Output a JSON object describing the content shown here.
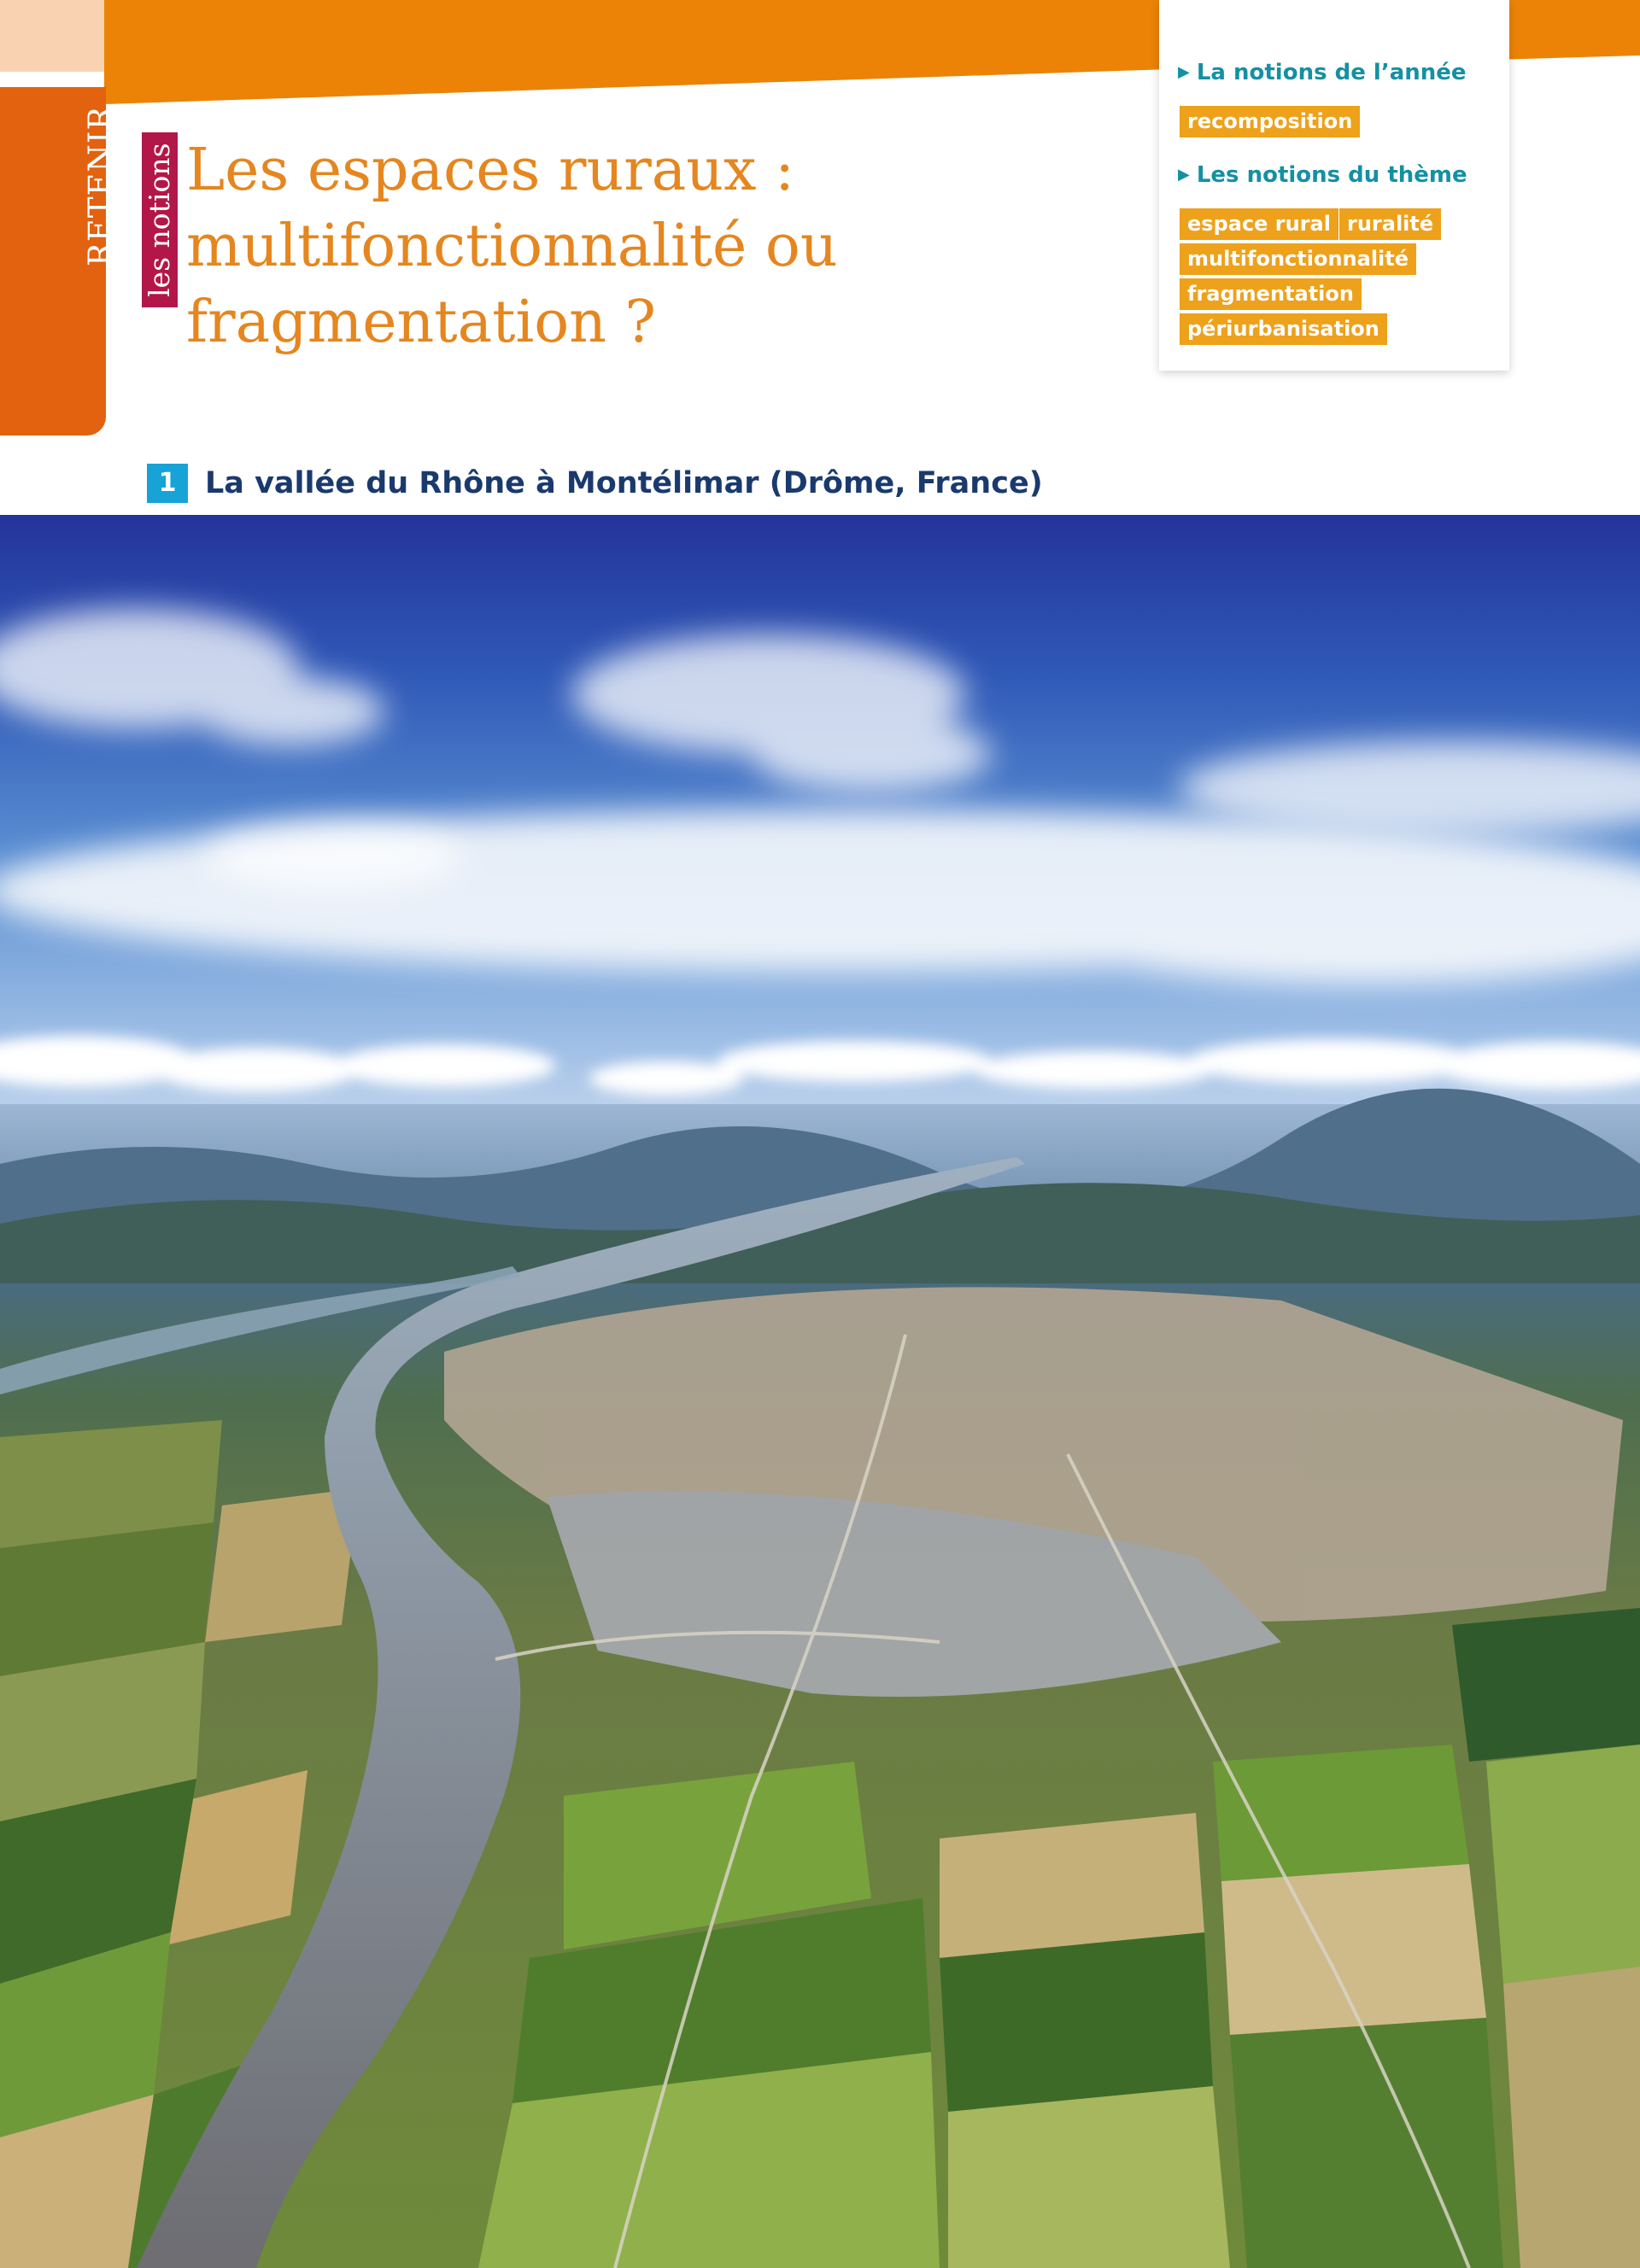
{
  "side_tab": {
    "retenir": "RETENIR",
    "notions": "les notions"
  },
  "title": {
    "line1": "Les espaces ruraux :",
    "line2": "multifonctionnalité ou",
    "line3": "fragmentation ?"
  },
  "notions_box": {
    "year_heading": "La notions de l’année",
    "year_tags": [
      "recomposition"
    ],
    "theme_heading": "Les notions du thème",
    "theme_tags": [
      "espace rural",
      "ruralité",
      "multifonctionnalité",
      "fragmentation",
      "périurbanisation"
    ]
  },
  "document": {
    "number": "1",
    "caption": "La vallée du Rhône à Montélimar (Drôme, France)"
  },
  "colors": {
    "band_orange": "#ec8306",
    "tab_orange": "#e2620f",
    "notions_crimson": "#b3174a",
    "title_orange": "#e5861f",
    "heading_teal": "#1590a3",
    "tag_yellow": "#eea11b",
    "doc_blue": "#17a3d6",
    "caption_navy": "#1a3a6e"
  }
}
